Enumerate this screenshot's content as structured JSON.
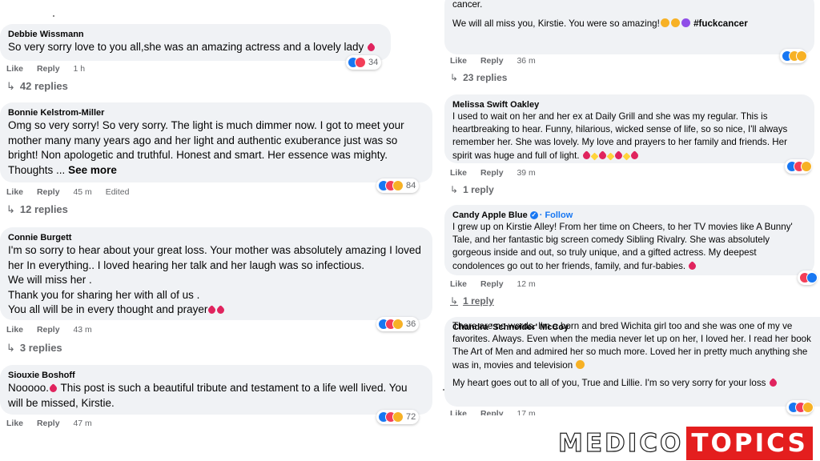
{
  "left_comments": [
    {
      "author": "Debbie Wissmann",
      "text": "So very sorry love to you all,she was an amazing actress and a lovely lady",
      "actions": {
        "like": "Like",
        "reply": "Reply",
        "time": "1 h",
        "edited": ""
      },
      "reactions": {
        "count": "34"
      },
      "replies": "42 replies"
    },
    {
      "author": "Bonnie Kelstrom-Miller",
      "text": "Omg so very sorry! So very sorry. The light is much dimmer now. I got to meet your mother many many years ago and her light and authentic exuberance just was so bright! Non apologetic and truthful. Honest and smart. Her essence was mighty. Thoughts ...",
      "see_more": "See more",
      "actions": {
        "like": "Like",
        "reply": "Reply",
        "time": "45 m",
        "edited": "Edited"
      },
      "reactions": {
        "count": "84"
      },
      "replies": "12 replies"
    },
    {
      "author": "Connie Burgett",
      "text": "I'm so sorry to hear about your great loss. Your mother was absolutely amazing I loved her In everything.. I loved hearing her talk and her laugh was so infectious.\nWe will miss her .\nThank you for sharing her with all of us .\nYou all will be in every thought and prayer",
      "actions": {
        "like": "Like",
        "reply": "Reply",
        "time": "43 m",
        "edited": ""
      },
      "reactions": {
        "count": "36"
      },
      "replies": "3 replies"
    },
    {
      "author": "Siouxie Boshoff",
      "text_a": "Nooooo.",
      "text_b": " This post is such a beautiful tribute and testament to a life well lived. You will be missed, Kirstie.",
      "actions": {
        "like": "Like",
        "reply": "Reply",
        "time": "47 m",
        "edited": ""
      },
      "reactions": {
        "count": "72"
      }
    }
  ],
  "right_comments": [
    {
      "cut_text": "cancer.",
      "text": "We will all miss you, Kirstie. You were so amazing!",
      "hashtag": "#fuckcancer",
      "actions": {
        "like": "Like",
        "reply": "Reply",
        "time": "36 m"
      },
      "replies": "23 replies"
    },
    {
      "author": "Melissa Swift Oakley",
      "text": "I used to wait on her and her ex at Daily Grill and she was my regular. This is heartbreaking to hear. Funny, hilarious, wicked sense of life, so so nice, I'll always remember her. She was lovely. My love and prayers to her family and friends. Her spirit was huge and full of light.",
      "actions": {
        "like": "Like",
        "reply": "Reply",
        "time": "39 m"
      },
      "replies": "1 reply"
    },
    {
      "author": "Candy Apple Blue",
      "follow": "· Follow",
      "text": "I grew up on Kirstie Alley! From her time on Cheers, to her TV movies like A Bunny' Tale, and her fantastic big screen comedy Sibling Rivalry. She was absolutely gorgeous inside and out, so truly unique, and a gifted actress. My deepest condolences go out to her friends, family, and fur-babies.",
      "actions": {
        "like": "Like",
        "reply": "Reply",
        "time": "12 m"
      },
      "replies": "1 reply"
    },
    {
      "author": "Chandra 'Schneider' McCoy",
      "text": "There are no words. I'm a born and bred Wichita girl too and she was one of my ve favorites. Always. Even when the media never let up on her, I loved her. I read her book The Art of Men and admired her so much more. Loved her in pretty much anything she was in, movies and television",
      "text2": "My heart goes out to all of you, True and Lillie. I'm so very sorry for your loss",
      "actions": {
        "like": "Like",
        "reply": "Reply",
        "time": "17 m"
      }
    }
  ],
  "logo": {
    "part1": "MEDICO",
    "part2": "TOPICS"
  },
  "colors": {
    "bubble": "#f0f2f5",
    "meta": "#65676b",
    "like": "#1877f2",
    "love": "#f33e58",
    "care": "#f7b125",
    "logo_red": "#e41e1e"
  }
}
